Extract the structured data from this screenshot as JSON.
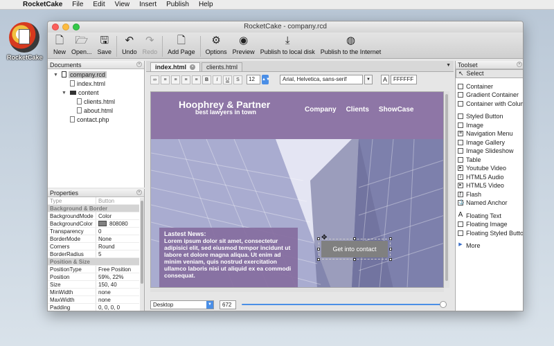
{
  "menubar": {
    "app": "RocketCake",
    "items": [
      "File",
      "Edit",
      "View",
      "Insert",
      "Publish",
      "Help"
    ]
  },
  "desktop": {
    "icon_label": "RocketCake"
  },
  "window": {
    "title": "RocketCake - company.rcd"
  },
  "toolbar": {
    "new": "New",
    "open": "Open...",
    "save": "Save",
    "undo": "Undo",
    "redo": "Redo",
    "add_page": "Add Page",
    "options": "Options",
    "preview": "Preview",
    "publish_local": "Publish to local disk",
    "publish_internet": "Publish to the Internet"
  },
  "documents": {
    "title": "Documents",
    "tree": {
      "project": "company.rcd",
      "index": "index.html",
      "folder": "content",
      "clients": "clients.html",
      "about": "about.html",
      "contact": "contact.php"
    }
  },
  "properties": {
    "title": "Properties",
    "rows": [
      {
        "k": "Type",
        "v": "Button",
        "muted": true
      },
      {
        "group": "Background & Border"
      },
      {
        "k": "BackgroundMode",
        "v": "Color"
      },
      {
        "k": "BackgroundColor",
        "v": "808080",
        "swatch": "#808080"
      },
      {
        "k": "Transparency",
        "v": "0"
      },
      {
        "k": "BorderMode",
        "v": "None"
      },
      {
        "k": "Corners",
        "v": "Round"
      },
      {
        "k": "BorderRadius",
        "v": "5"
      },
      {
        "group": "Position & Size"
      },
      {
        "k": "PositionType",
        "v": "Free Position"
      },
      {
        "k": "Position",
        "v": "59%, 22%"
      },
      {
        "k": "Size",
        "v": "150, 40"
      },
      {
        "k": "MinWidth",
        "v": "none"
      },
      {
        "k": "MaxWidth",
        "v": "none"
      },
      {
        "k": "Padding",
        "v": "0, 0, 0, 0"
      }
    ]
  },
  "tabs": {
    "active": "index.html",
    "other": "clients.html"
  },
  "format": {
    "font_size": "12",
    "font_family": "Arial, Helvetica, sans-serif",
    "a_label": "A",
    "color": "FFFFFF"
  },
  "site": {
    "title": "Hoophrey & Partner",
    "subtitle": "best lawyers in town",
    "nav": [
      "Company",
      "Clients",
      "ShowCase"
    ],
    "news_heading": "Lastest News:",
    "news_body": "Lorem ipsum dolor sit amet, consectetur adipisici elit, sed eiusmod tempor incidunt ut labore et dolore magna aliqua. Ut enim ad minim veniam, quis nostrud exercitation ullamco laboris nisi ut aliquid ex ea commodi consequat.",
    "cta": "Get into contact"
  },
  "status": {
    "device": "Desktop",
    "width": "672",
    "slider_fraction": 1.0
  },
  "toolset": {
    "title": "Toolset",
    "select": "Select",
    "groups": [
      [
        "Container",
        "Gradient Container",
        "Container with Columns"
      ],
      [
        "Styled Button",
        "Image",
        "Navigation Menu",
        "Image Gallery",
        "Image Slideshow",
        "Table",
        "Youtube Video",
        "HTML5 Audio",
        "HTML5 Video",
        "Flash",
        "Named Anchor"
      ],
      [
        "Floating Text",
        "Floating Image",
        "Floating Styled Button"
      ],
      [
        "More"
      ]
    ]
  },
  "colors": {
    "header_purple": "#8e76a6",
    "accent_blue": "#4a8ee6"
  }
}
